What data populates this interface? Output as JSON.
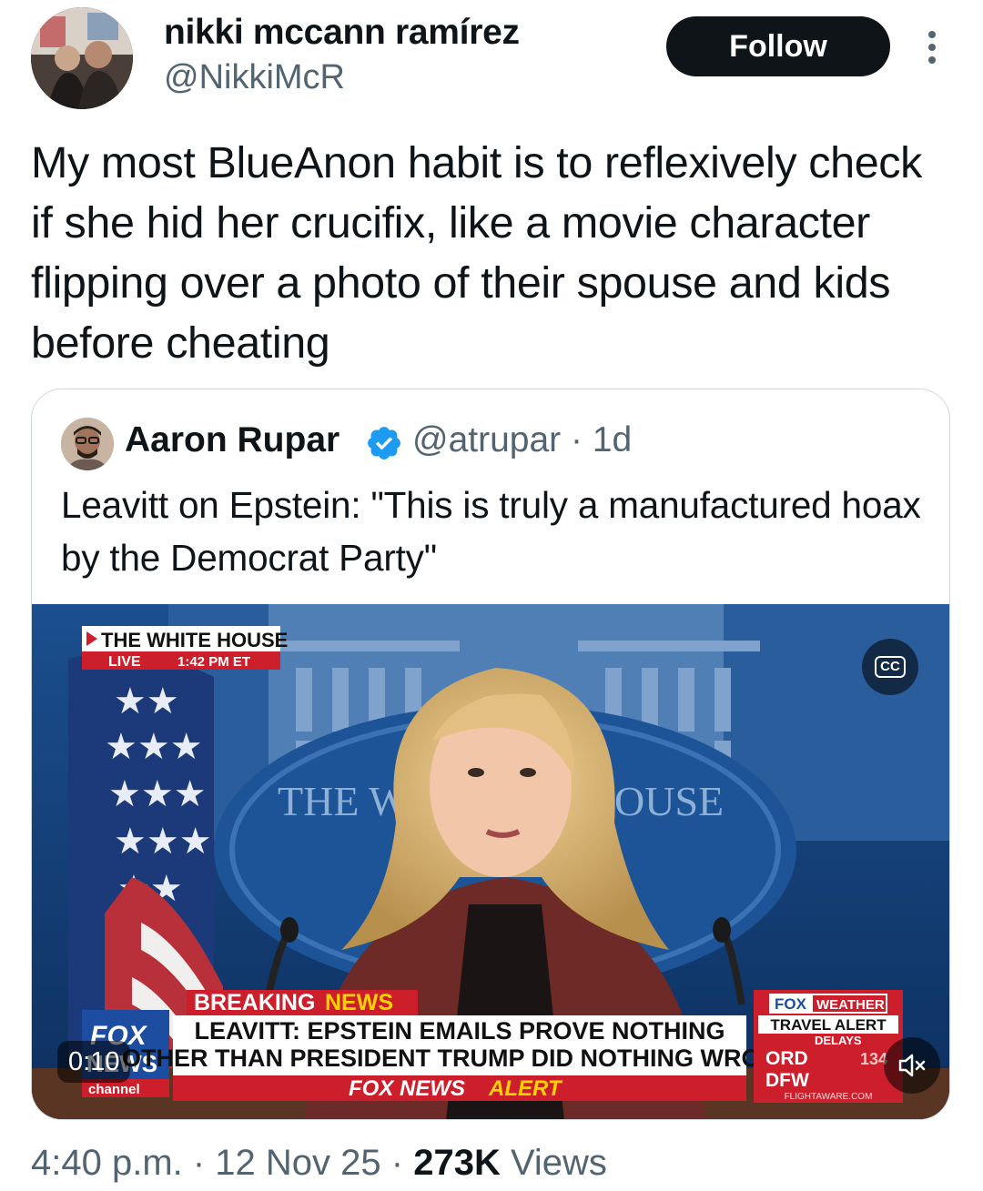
{
  "tweet": {
    "author": {
      "name": "nikki mccann ramírez",
      "handle": "@NikkiMcR"
    },
    "follow_label": "Follow",
    "text": "My most BlueAnon habit is to reflexively check if she hid her crucifix, like a movie character flipping over a photo of their spouse and kids before cheating",
    "timestamp": "4:40 p.m. · 12 Nov 25 · ",
    "views_count": "273K",
    "views_label": " Views"
  },
  "quote": {
    "author": {
      "name": "Aaron Rupar",
      "handle": "@atrupar · 1d",
      "verified": true
    },
    "text": "Leavitt on Epstein: \"This is truly a manufactured hoax by the Democrat Party\"",
    "video": {
      "duration": "0:10",
      "cc_label": "CC",
      "bug_location": "THE WHITE HOUSE",
      "bug_live": "LIVE",
      "bug_time": "1:42 PM ET",
      "backdrop_left": "THE W",
      "backdrop_right": "OUSE",
      "breaking_word1": "BREAKING",
      "breaking_word2": "NEWS",
      "headline_line1": "LEAVITT: EPSTEIN EMAILS PROVE NOTHING",
      "headline_line2": "OTHER THAN PRESIDENT TRUMP DID NOTHING WRONG",
      "alert_word1": "FOX NEWS",
      "alert_word2": "ALERT",
      "logo_line1": "FOX",
      "logo_line2": "NEWS",
      "logo_line3": "channel",
      "weather_brand1": "FOX",
      "weather_brand2": "WEATHER",
      "weather_title": "TRAVEL ALERT",
      "weather_sub": "DELAYS",
      "weather_city1": "ORD",
      "weather_city2": "DFW",
      "weather_num": "134",
      "weather_source": "FLIGHTAWARE.COM"
    }
  },
  "colors": {
    "text_primary": "#0f1419",
    "text_secondary": "#536471",
    "verified_blue": "#1d9bf0",
    "fox_red": "#cc1f2b",
    "fox_yellow": "#ffd200"
  }
}
